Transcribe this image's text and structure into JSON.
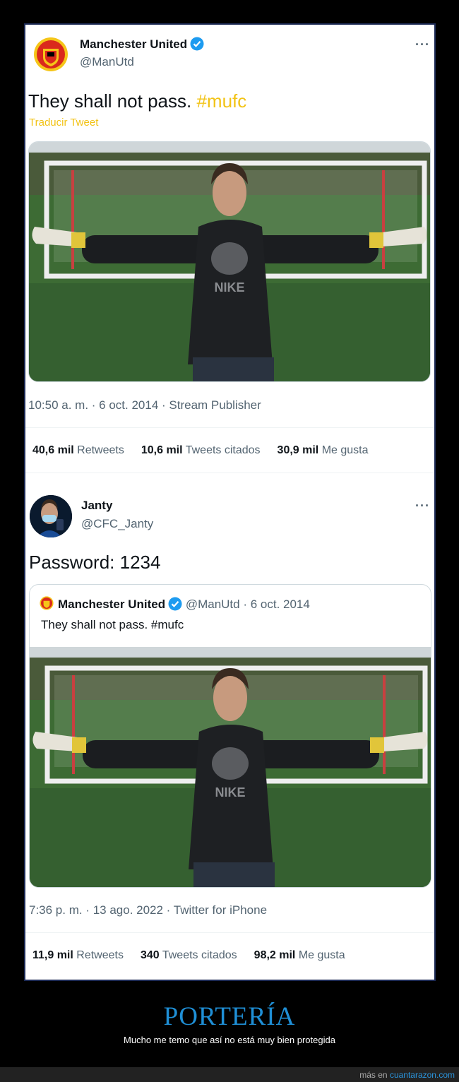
{
  "tweet1": {
    "author_name": "Manchester United",
    "author_handle": "@ManUtd",
    "more": "···",
    "text": "They shall not pass.",
    "hashtag": "#mufc",
    "translate": "Traducir Tweet",
    "photo_shirt_text": "NIKE",
    "meta": "10:50 a. m. · 6 oct. 2014 · Stream Publisher",
    "stats": [
      {
        "count": "40,6 mil",
        "label": "Retweets"
      },
      {
        "count": "10,6 mil",
        "label": "Tweets citados"
      },
      {
        "count": "30,9 mil",
        "label": "Me gusta"
      }
    ]
  },
  "tweet2": {
    "author_name": "Janty",
    "author_handle": "@CFC_Janty",
    "more": "···",
    "text": "Password: 1234",
    "quote": {
      "name": "Manchester United",
      "handle_date": "@ManUtd · 6 oct. 2014",
      "text": "They shall not pass. #mufc",
      "photo_shirt_text": "NIKE"
    },
    "meta": "7:36 p. m. · 13 ago. 2022 · Twitter for iPhone",
    "stats": [
      {
        "count": "11,9 mil",
        "label": "Retweets"
      },
      {
        "count": "340",
        "label": "Tweets citados"
      },
      {
        "count": "98,2 mil",
        "label": "Me gusta"
      }
    ]
  },
  "caption": {
    "title": "PORTERÍA",
    "subtitle": "Mucho me temo que así no está muy bien protegida"
  },
  "footer": {
    "prefix": "más en",
    "site": "cuantarazon.com"
  },
  "colors": {
    "hashtag": "#f2c316",
    "verified": "#1d9bf0",
    "caption_title": "#1f8fd6",
    "link": "#2b95dd"
  }
}
